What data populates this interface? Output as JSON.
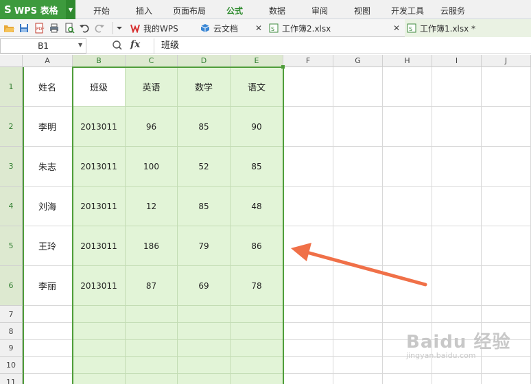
{
  "app": {
    "logo_text": "WPS 表格",
    "logo_letter": "S",
    "accent": "#3d9a3d"
  },
  "menu": [
    "开始",
    "插入",
    "页面布局",
    "公式",
    "数据",
    "审阅",
    "视图",
    "开发工具",
    "云服务"
  ],
  "menu_active_index": 3,
  "tabs": {
    "t1": "我的WPS",
    "t2": "云文档",
    "t3": "工作簿2.xlsx",
    "t4": "工作簿1.xlsx *"
  },
  "formula_bar": {
    "name_box": "B1",
    "fx": "fx",
    "value": "班级"
  },
  "columns": [
    "A",
    "B",
    "C",
    "D",
    "E",
    "F",
    "G",
    "H",
    "I",
    "J"
  ],
  "selected_columns": [
    "B",
    "C",
    "D",
    "E"
  ],
  "rows": [
    "1",
    "2",
    "3",
    "4",
    "5",
    "6",
    "7",
    "8",
    "9",
    "10",
    "11"
  ],
  "table": {
    "r1": [
      "姓名",
      "班级",
      "英语",
      "数学",
      "语文"
    ],
    "r2": [
      "李明",
      "2013011",
      "96",
      "85",
      "90"
    ],
    "r3": [
      "朱志",
      "2013011",
      "100",
      "52",
      "85"
    ],
    "r4": [
      "刘海",
      "2013011",
      "12",
      "85",
      "48"
    ],
    "r5": [
      "王玲",
      "2013011",
      "186",
      "79",
      "86"
    ],
    "r6": [
      "李丽",
      "2013011",
      "87",
      "69",
      "78"
    ]
  },
  "watermark": {
    "text": "Baidu 经验",
    "sub": "jingyan.baidu.com"
  },
  "colors": {
    "selection_border": "#4f9d3a",
    "selection_fill": "#e2f4d7",
    "arrow": "#f07048"
  }
}
